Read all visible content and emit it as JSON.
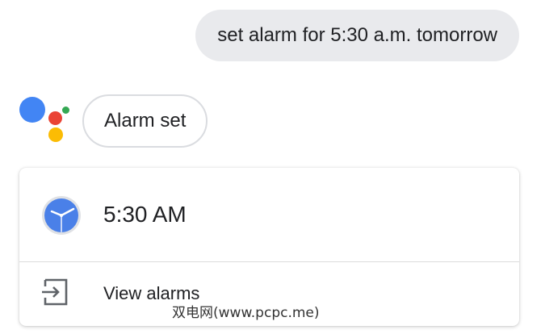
{
  "user_message": {
    "text": "set alarm for 5:30 a.m. tomorrow"
  },
  "assistant": {
    "logo_icon": "google-assistant-icon",
    "reply_text": "Alarm set",
    "logo_colors": {
      "blue": "#4285f4",
      "red": "#ea4335",
      "yellow": "#fbbc04",
      "green": "#34a853"
    }
  },
  "alarm_card": {
    "icon": "clock-icon",
    "time": "5:30 AM",
    "action_icon": "exit-to-app-icon",
    "action_label": "View alarms"
  },
  "watermark": {
    "text": "双电网(www.pcpc.me)"
  }
}
